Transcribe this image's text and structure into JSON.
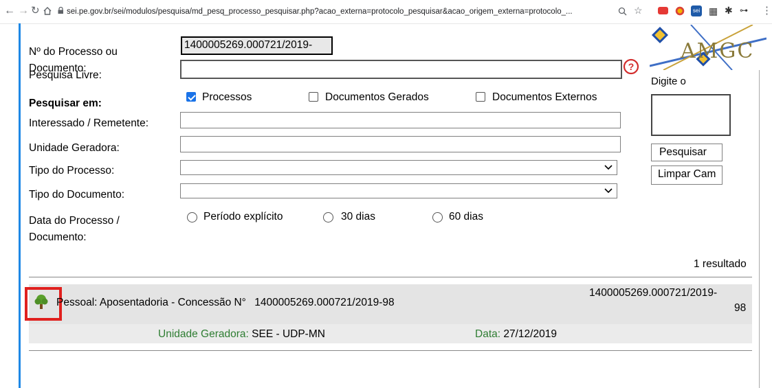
{
  "browser": {
    "url": "sei.pe.gov.br/sei/modulos/pesquisa/md_pesq_processo_pesquisar.php?acao_externa=protocolo_pesquisar&acao_origem_externa=protocolo_..."
  },
  "form": {
    "numero_label": "Nº do Processo ou Documento:",
    "numero_value": "1400005269.000721/2019-",
    "pesquisa_livre_label": "Pesquisa Livre:",
    "pesquisar_em_label": "Pesquisar em:",
    "checkboxes": [
      {
        "label": "Processos",
        "checked": true
      },
      {
        "label": "Documentos Gerados",
        "checked": false
      },
      {
        "label": "Documentos Externos",
        "checked": false
      }
    ],
    "interessado_label": "Interessado / Remetente:",
    "unidade_label": "Unidade Geradora:",
    "tipo_processo_label": "Tipo do Processo:",
    "tipo_documento_label": "Tipo do Documento:",
    "data_label_1": "Data do Processo /",
    "data_label_2": "Documento:",
    "radios": [
      {
        "label": "Período explícito"
      },
      {
        "label": "30 dias"
      },
      {
        "label": "60 dias"
      }
    ]
  },
  "captcha": {
    "logo_text": "AMGC",
    "prompt": "Digite o"
  },
  "buttons": {
    "pesquisar": "Pesquisar",
    "limpar": "Limpar Cam"
  },
  "results": {
    "count": "1 resultado",
    "items": [
      {
        "title": "Pessoal: Aposentadoria - Concessão N°",
        "numero": "1400005269.000721/2019-98",
        "right_line1": "1400005269.000721/2019-",
        "right_line2": "98",
        "unidade_label": "Unidade Geradora:",
        "unidade_value": "SEE - UDP-MN",
        "data_label": "Data:",
        "data_value": "27/12/2019"
      }
    ]
  },
  "colors": {
    "accent_border": "#1e88e5",
    "highlight_box": "#e0201e",
    "meta_green": "#2e7d32"
  }
}
